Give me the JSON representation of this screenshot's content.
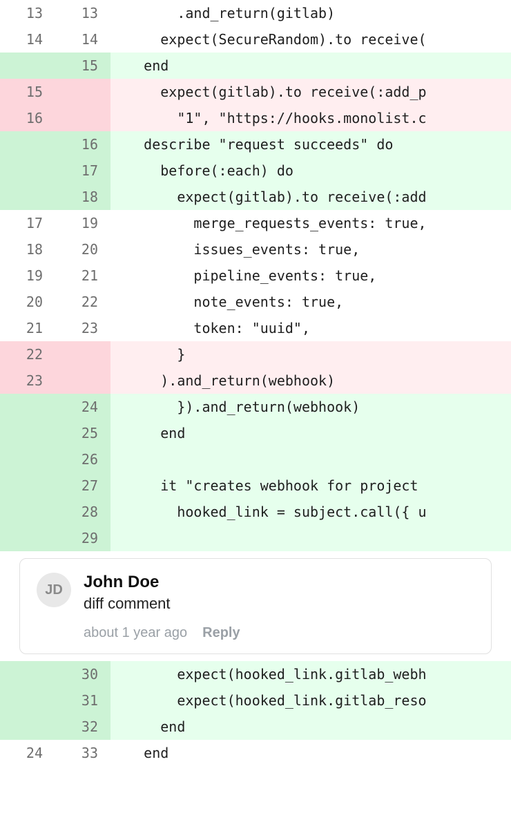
{
  "diff": {
    "rows": [
      {
        "type": "ctx",
        "old": "13",
        "new": "13",
        "code": "        .and_return(gitlab)"
      },
      {
        "type": "ctx",
        "old": "14",
        "new": "14",
        "code": "      expect(SecureRandom).to receive("
      },
      {
        "type": "add",
        "old": "",
        "new": "15",
        "code": "    end"
      },
      {
        "type": "del",
        "old": "15",
        "new": "",
        "code": "      expect(gitlab).to receive(:add_p"
      },
      {
        "type": "del",
        "old": "16",
        "new": "",
        "code": "        \"1\", \"https://hooks.monolist.c"
      },
      {
        "type": "add",
        "old": "",
        "new": "16",
        "code": "    describe \"request succeeds\" do"
      },
      {
        "type": "add",
        "old": "",
        "new": "17",
        "code": "      before(:each) do"
      },
      {
        "type": "add",
        "old": "",
        "new": "18",
        "code": "        expect(gitlab).to receive(:add"
      },
      {
        "type": "ctx",
        "old": "17",
        "new": "19",
        "code": "          merge_requests_events: true,"
      },
      {
        "type": "ctx",
        "old": "18",
        "new": "20",
        "code": "          issues_events: true,"
      },
      {
        "type": "ctx",
        "old": "19",
        "new": "21",
        "code": "          pipeline_events: true,"
      },
      {
        "type": "ctx",
        "old": "20",
        "new": "22",
        "code": "          note_events: true,"
      },
      {
        "type": "ctx",
        "old": "21",
        "new": "23",
        "code": "          token: \"uuid\","
      },
      {
        "type": "del",
        "old": "22",
        "new": "",
        "code": "        }"
      },
      {
        "type": "del",
        "old": "23",
        "new": "",
        "code": "      ).and_return(webhook)"
      },
      {
        "type": "add",
        "old": "",
        "new": "24",
        "code": "        }).and_return(webhook)"
      },
      {
        "type": "add",
        "old": "",
        "new": "25",
        "code": "      end"
      },
      {
        "type": "add",
        "old": "",
        "new": "26",
        "code": ""
      },
      {
        "type": "add",
        "old": "",
        "new": "27",
        "code": "      it \"creates webhook for project "
      },
      {
        "type": "add",
        "old": "",
        "new": "28",
        "code": "        hooked_link = subject.call({ u"
      },
      {
        "type": "add",
        "old": "",
        "new": "29",
        "code": ""
      }
    ],
    "rows_after": [
      {
        "type": "add",
        "old": "",
        "new": "30",
        "code": "        expect(hooked_link.gitlab_webh"
      },
      {
        "type": "add",
        "old": "",
        "new": "31",
        "code": "        expect(hooked_link.gitlab_reso"
      },
      {
        "type": "add",
        "old": "",
        "new": "32",
        "code": "      end"
      },
      {
        "type": "ctx",
        "old": "24",
        "new": "33",
        "code": "    end"
      }
    ]
  },
  "comment": {
    "initials": "JD",
    "author": "John Doe",
    "body": "diff comment",
    "timestamp": "about 1 year ago",
    "reply_label": "Reply"
  }
}
